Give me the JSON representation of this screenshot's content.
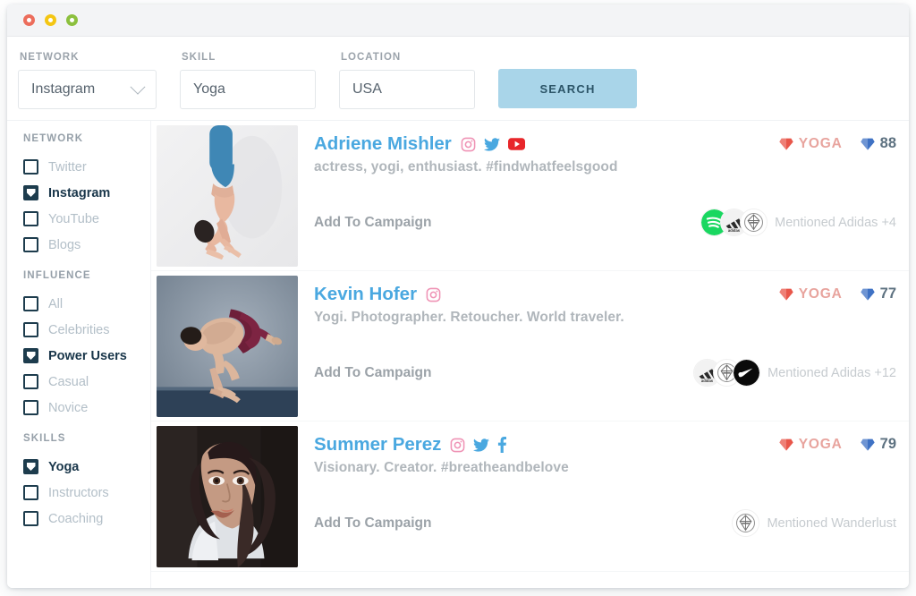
{
  "window": {
    "traffic_lights": [
      "close-red",
      "minimize-yellow",
      "maximize-green"
    ]
  },
  "search": {
    "network": {
      "label": "NETWORK",
      "value": "Instagram"
    },
    "skill": {
      "label": "SKILL",
      "value": "Yoga"
    },
    "location": {
      "label": "LOCATION",
      "value": "USA"
    },
    "button_label": "SEARCH",
    "button_color": "#a9d5e9"
  },
  "sidebar": {
    "groups": [
      {
        "title": "NETWORK",
        "items": [
          {
            "label": "Twitter",
            "checked": false
          },
          {
            "label": "Instagram",
            "checked": true
          },
          {
            "label": "YouTube",
            "checked": false
          },
          {
            "label": "Blogs",
            "checked": false
          }
        ]
      },
      {
        "title": "INFLUENCE",
        "items": [
          {
            "label": "All",
            "checked": false
          },
          {
            "label": "Celebrities",
            "checked": false
          },
          {
            "label": "Power Users",
            "checked": true
          },
          {
            "label": "Casual",
            "checked": false
          },
          {
            "label": "Novice",
            "checked": false
          }
        ]
      },
      {
        "title": "SKILLS",
        "items": [
          {
            "label": "Yoga",
            "checked": true
          },
          {
            "label": "Instructors",
            "checked": false
          },
          {
            "label": "Coaching",
            "checked": false
          }
        ]
      }
    ]
  },
  "results": [
    {
      "name": "Adriene Mishler",
      "networks": [
        "instagram",
        "twitter",
        "youtube"
      ],
      "bio": "actress, yogi, enthusiast. #findwhatfeelsgood",
      "add_label": "Add To Campaign",
      "skill_score_label": "YOGA",
      "influence_score": "88",
      "mention_text": "Mentioned Adidas +4",
      "brands": [
        "spotify",
        "adidas",
        "wanderlust"
      ],
      "photo": "handstand-yoga-pose"
    },
    {
      "name": "Kevin Hofer",
      "networks": [
        "instagram"
      ],
      "bio": "Yogi. Photographer. Retoucher. World traveler.",
      "add_label": "Add To Campaign",
      "skill_score_label": "YOGA",
      "influence_score": "77",
      "mention_text": "Mentioned Adidas +12",
      "brands": [
        "adidas",
        "wanderlust",
        "nike"
      ],
      "photo": "crow-yoga-pose"
    },
    {
      "name": "Summer Perez",
      "networks": [
        "instagram",
        "twitter",
        "facebook"
      ],
      "bio": "Visionary. Creator. #breatheandbelove",
      "add_label": "Add To Campaign",
      "skill_score_label": "YOGA",
      "influence_score": "79",
      "mention_text": "Mentioned Wanderlust",
      "brands": [
        "wanderlust"
      ],
      "photo": "portrait-woman"
    }
  ],
  "colors": {
    "name_link": "#4aa8e0",
    "checkbox_on": "#1d3c4d",
    "skill_gem": "#e8564a",
    "influence_gem": "#3f72c4",
    "skill_label": "#e8a49e"
  }
}
